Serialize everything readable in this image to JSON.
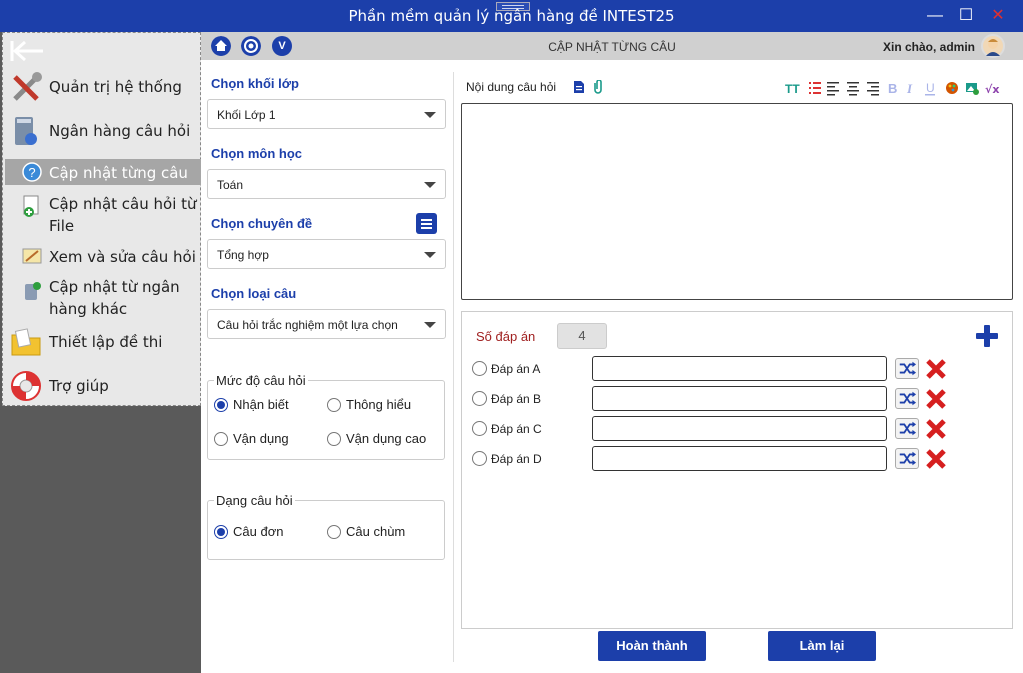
{
  "window": {
    "title": "Phần mềm quản lý ngân hàng đề INTEST25",
    "minimize": "—",
    "maximize": "☐",
    "close": "✕"
  },
  "sidebar": {
    "items": [
      {
        "label": "Quản trị hệ thống",
        "icon": "tools-icon"
      },
      {
        "label": "Ngân hàng câu hỏi",
        "icon": "database-icon"
      },
      {
        "label": "Cập nhật từng câu",
        "icon": "help-icon",
        "active": true
      },
      {
        "label": "Cập nhật câu hỏi từ File",
        "icon": "file-add-icon"
      },
      {
        "label": "Xem và sửa câu hỏi",
        "icon": "edit-icon"
      },
      {
        "label": "Cập nhật từ ngân hàng khác",
        "icon": "import-icon"
      },
      {
        "label": "Thiết lập đề thi",
        "icon": "folder-icon"
      },
      {
        "label": "Trợ giúp",
        "icon": "lifebuoy-icon"
      }
    ]
  },
  "topbar": {
    "title": "CẬP NHẬT TỪNG CÂU",
    "greeting": "Xin chào, admin",
    "icons": [
      "home-icon",
      "lifebuoy-icon",
      "v-icon"
    ],
    "v_label": "V"
  },
  "form": {
    "grade_label": "Chọn khối lớp",
    "grade_value": "Khối Lớp 1",
    "subject_label": "Chọn môn học",
    "subject_value": "Toán",
    "topic_label": "Chọn chuyên đề",
    "topic_value": "Tổng hợp",
    "type_label": "Chọn loại câu",
    "type_value": "Câu hỏi trắc nghiệm một lựa chọn",
    "level_legend": "Mức độ câu hỏi",
    "levels": [
      "Nhận biết",
      "Thông hiểu",
      "Vận dụng",
      "Vận dụng cao"
    ],
    "level_selected": "Nhận biết",
    "kind_legend": "Dạng câu hỏi",
    "kinds": [
      "Câu đơn",
      "Câu chùm"
    ],
    "kind_selected": "Câu đơn"
  },
  "editor": {
    "label": "Nội dung câu hỏi",
    "toolbar": [
      "font-size-icon",
      "list-icon",
      "align-left-icon",
      "align-center-icon",
      "align-right-icon",
      "bold-icon",
      "italic-icon",
      "underline-icon",
      "palette-icon",
      "image-icon",
      "formula-icon"
    ]
  },
  "answers": {
    "count_label": "Số đáp án",
    "count": "4",
    "rows": [
      {
        "label": "Đáp án A",
        "value": ""
      },
      {
        "label": "Đáp án B",
        "value": ""
      },
      {
        "label": "Đáp án C",
        "value": ""
      },
      {
        "label": "Đáp án D",
        "value": ""
      }
    ]
  },
  "actions": {
    "finish": "Hoàn thành",
    "reset": "Làm lại"
  },
  "colors": {
    "primary": "#1c3faa",
    "danger": "#d61f1f",
    "sidebar_bg": "#5a5a5a"
  }
}
